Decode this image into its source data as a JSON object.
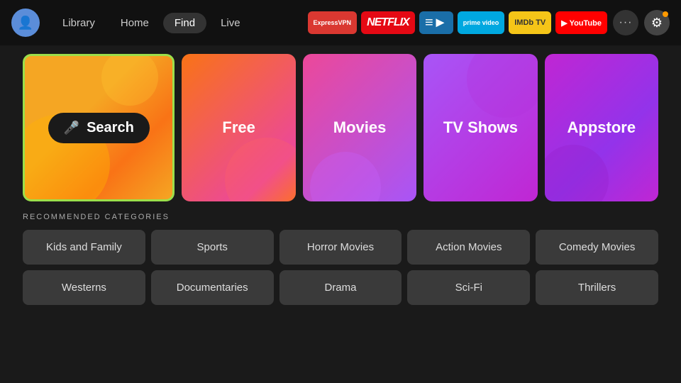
{
  "nav": {
    "avatar_icon": "👤",
    "links": [
      {
        "label": "Library",
        "active": false
      },
      {
        "label": "Home",
        "active": false
      },
      {
        "label": "Find",
        "active": true
      },
      {
        "label": "Live",
        "active": false
      }
    ],
    "apps": [
      {
        "id": "expressvpn",
        "label": "ExpressVPN"
      },
      {
        "id": "netflix",
        "label": "NETFLIX"
      },
      {
        "id": "freevee",
        "label": "▶"
      },
      {
        "id": "prime",
        "label": "prime video"
      },
      {
        "id": "imdb",
        "label": "IMDb TV"
      },
      {
        "id": "youtube",
        "label": "▶ YouTube"
      }
    ],
    "more_label": "···",
    "settings_icon": "⚙"
  },
  "tiles": [
    {
      "id": "search",
      "label": "Search",
      "type": "search"
    },
    {
      "id": "free",
      "label": "Free",
      "type": "free"
    },
    {
      "id": "movies",
      "label": "Movies",
      "type": "movies"
    },
    {
      "id": "tvshows",
      "label": "TV Shows",
      "type": "tvshows"
    },
    {
      "id": "appstore",
      "label": "Appstore",
      "type": "appstore"
    }
  ],
  "recommended": {
    "title": "RECOMMENDED CATEGORIES",
    "row1": [
      {
        "label": "Kids and Family"
      },
      {
        "label": "Sports"
      },
      {
        "label": "Horror Movies"
      },
      {
        "label": "Action Movies"
      },
      {
        "label": "Comedy Movies"
      }
    ],
    "row2": [
      {
        "label": "Westerns"
      },
      {
        "label": "Documentaries"
      },
      {
        "label": "Drama"
      },
      {
        "label": "Sci-Fi"
      },
      {
        "label": "Thrillers"
      }
    ]
  }
}
